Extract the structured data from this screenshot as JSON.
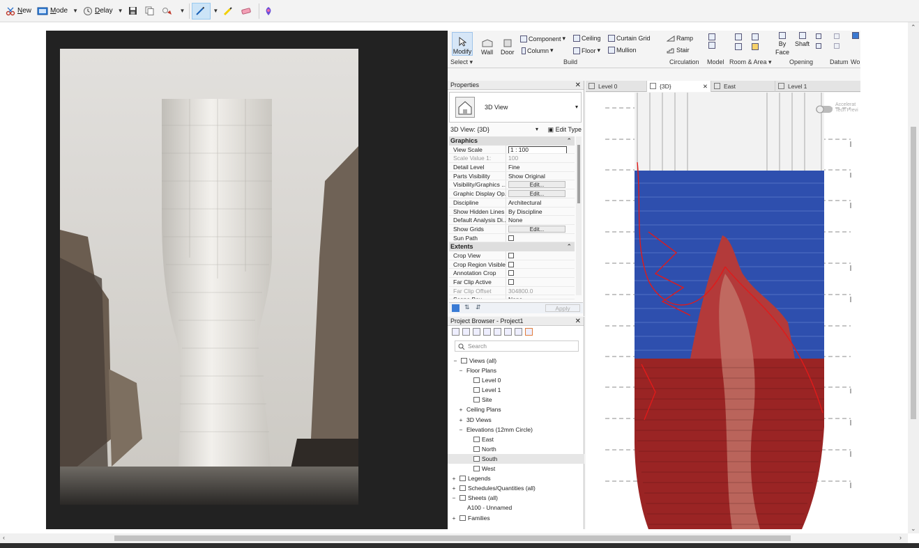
{
  "toolbar": {
    "new_label": "New",
    "mode_label": "Mode",
    "delay_label": "Delay"
  },
  "ribbon": {
    "modify": "Modify",
    "wall": "Wall",
    "door": "Door",
    "component": "Component",
    "column": "Column",
    "ceiling": "Ceiling",
    "floor": "Floor",
    "curtain_grid": "Curtain Grid",
    "mullion": "Mullion",
    "ramp": "Ramp",
    "stair": "Stair",
    "by_face_1": "By",
    "by_face_2": "Face",
    "shaft": "Shaft",
    "groups": {
      "select": "Select",
      "build": "Build",
      "circulation": "Circulation",
      "model": "Model",
      "room_area": "Room & Area",
      "opening": "Opening",
      "datum": "Datum",
      "work": "Wo"
    }
  },
  "properties": {
    "title": "Properties",
    "type_name": "3D View",
    "view_selector": "3D View: {3D}",
    "edit_type": "Edit Type",
    "sections": {
      "graphics": "Graphics",
      "extents": "Extents"
    },
    "rows": {
      "view_scale": {
        "k": "View Scale",
        "v": "1 : 100"
      },
      "scale_value": {
        "k": "Scale Value    1:",
        "v": "100"
      },
      "detail_level": {
        "k": "Detail Level",
        "v": "Fine"
      },
      "parts_visibility": {
        "k": "Parts Visibility",
        "v": "Show Original"
      },
      "vis_graphics": {
        "k": "Visibility/Graphics ...",
        "v": "Edit..."
      },
      "graphic_display": {
        "k": "Graphic Display Op...",
        "v": "Edit..."
      },
      "discipline": {
        "k": "Discipline",
        "v": "Architectural"
      },
      "hidden_lines": {
        "k": "Show Hidden Lines",
        "v": "By Discipline"
      },
      "analysis": {
        "k": "Default Analysis Di...",
        "v": "None"
      },
      "show_grids": {
        "k": "Show Grids",
        "v": "Edit..."
      },
      "sun_path": {
        "k": "Sun Path",
        "v": ""
      },
      "crop_view": {
        "k": "Crop View",
        "v": ""
      },
      "crop_region": {
        "k": "Crop Region Visible",
        "v": ""
      },
      "annotation_crop": {
        "k": "Annotation Crop",
        "v": ""
      },
      "far_clip": {
        "k": "Far Clip Active",
        "v": ""
      },
      "far_clip_offset": {
        "k": "Far Clip Offset",
        "v": "304800.0"
      },
      "scope_box": {
        "k": "Scope Box",
        "v": "None"
      }
    },
    "apply": "Apply"
  },
  "browser": {
    "title": "Project Browser - Project1",
    "search_placeholder": "Search",
    "tree": {
      "views_all": "Views (all)",
      "floor_plans": "Floor Plans",
      "level0": "Level 0",
      "level1": "Level 1",
      "site": "Site",
      "ceiling_plans": "Ceiling Plans",
      "views3d": "3D Views",
      "elevations": "Elevations (12mm Circle)",
      "east": "East",
      "north": "North",
      "south": "South",
      "west": "West",
      "legends": "Legends",
      "schedules": "Schedules/Quantities (all)",
      "sheets": "Sheets (all)",
      "a100": "A100 - Unnamed",
      "families": "Families"
    }
  },
  "tabs": {
    "level0": "Level 0",
    "view3d": "{3D}",
    "east": "East",
    "level1": "Level 1"
  },
  "viewport": {
    "accel_1": "Accelerat",
    "accel_2": "Tech Previ"
  },
  "colors": {
    "accent": "#0078d4",
    "model_blue": "#2e4fae",
    "model_red": "#9a2424",
    "sketch_red": "#e01a1a"
  }
}
